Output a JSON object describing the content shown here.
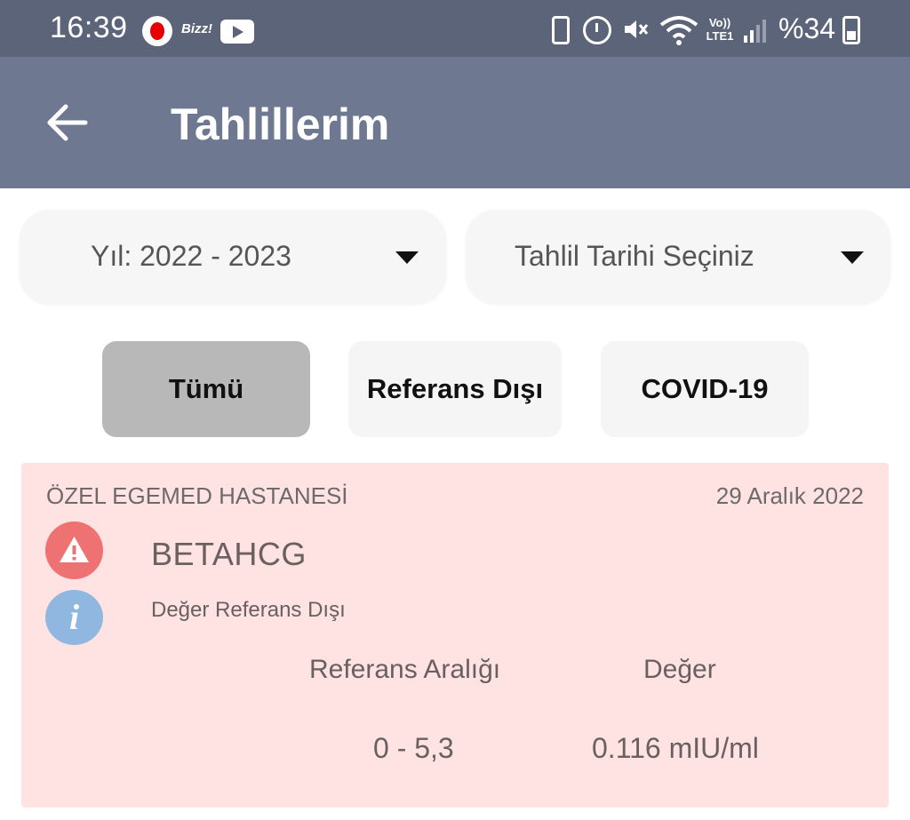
{
  "status_bar": {
    "time": "16:39",
    "carrier_badge": "Bizz!",
    "network": "Vo)) LTE1",
    "battery": "%34",
    "icons": [
      "vodafone-icon",
      "youtube-icon",
      "battery-saver-icon",
      "alarm-icon",
      "mute-icon",
      "wifi-icon",
      "volte-icon",
      "signal-icon",
      "battery-icon"
    ]
  },
  "app_bar": {
    "title": "Tahlillerim",
    "back_icon": "arrow-left-icon"
  },
  "filters": {
    "year_dropdown": "Yıl: 2022 - 2023",
    "date_dropdown": "Tahlil Tarihi Seçiniz"
  },
  "chips": [
    {
      "label": "Tümü",
      "selected": true
    },
    {
      "label": "Referans Dışı",
      "selected": false
    },
    {
      "label": "COVID-19",
      "selected": false
    }
  ],
  "result_card": {
    "hospital": "ÖZEL EGEMED HASTANESİ",
    "date": "29 Aralık 2022",
    "test_name": "BETAHCG",
    "status": "Değer Referans Dışı",
    "headers": {
      "reference": "Referans Aralığı",
      "value": "Değer"
    },
    "reference_range": "0 - 5,3",
    "value": "0.116 mIU/ml",
    "background_color": "#ffe2e2",
    "warning_color": "#ee7272",
    "info_color": "#8fb7df",
    "info_glyph": "i"
  }
}
